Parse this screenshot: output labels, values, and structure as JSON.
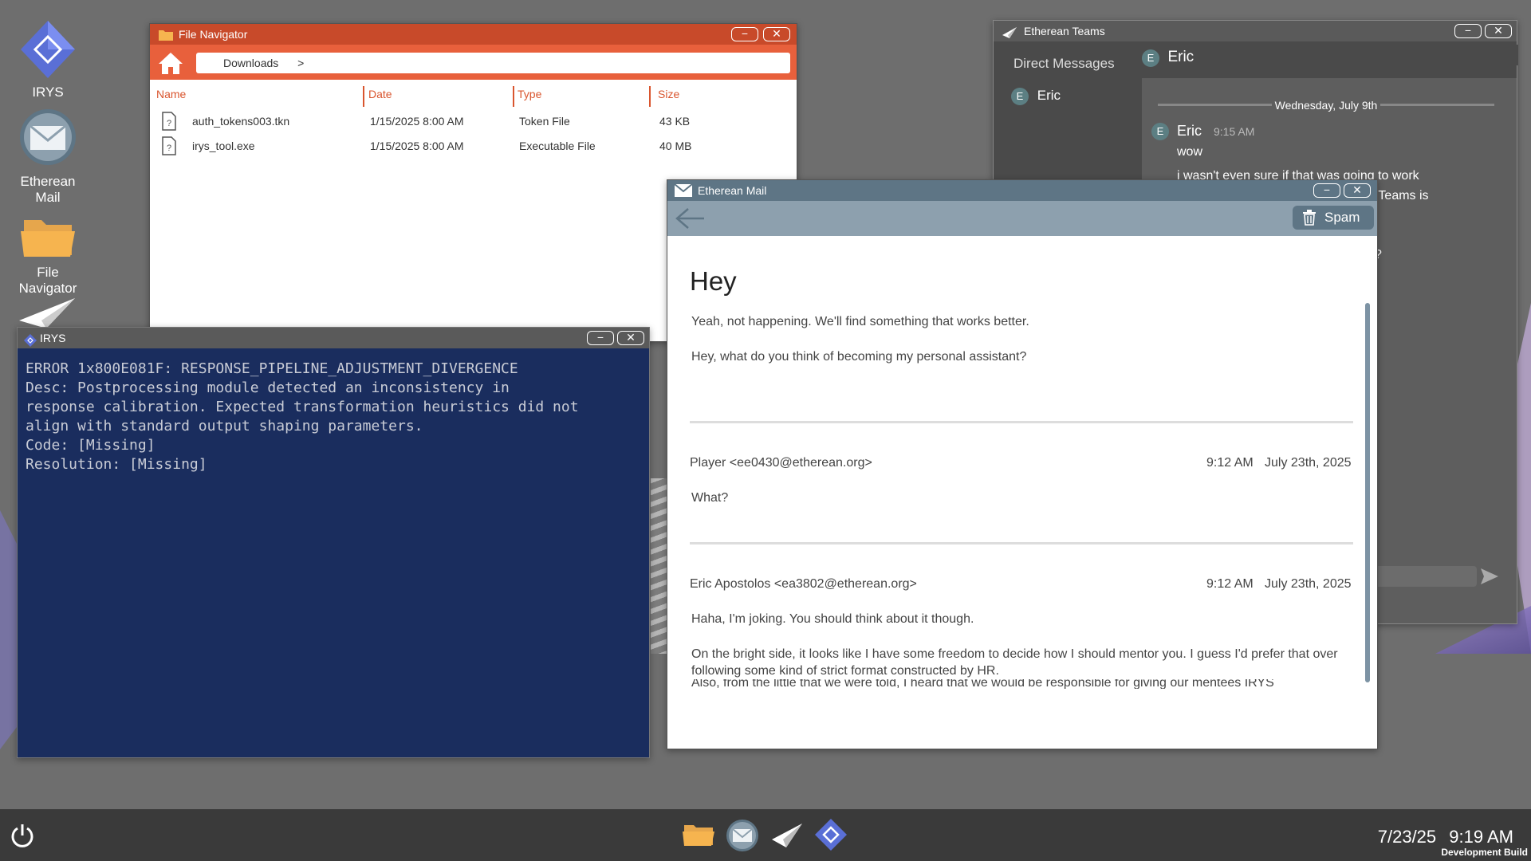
{
  "colors": {
    "desktop_bg": "#6e6e6e",
    "file_nav_accent": "#e8603c",
    "irys_console_bg": "#1a2d5e",
    "mail_accent": "#8da0ae",
    "teams_bg": "#4a4a4a",
    "taskbar_bg": "#3a3a3a"
  },
  "desktop_icons": [
    {
      "label": "IRYS",
      "icon": "irys-diamond-icon"
    },
    {
      "label": "Etherean\nMail",
      "icon": "mail-envelope-icon"
    },
    {
      "label": "File\nNavigator",
      "icon": "folder-icon"
    },
    {
      "label": "",
      "icon": "paper-plane-icon"
    }
  ],
  "file_navigator": {
    "title": "File Navigator",
    "path": "Downloads",
    "path_separator": ">",
    "columns": [
      "Name",
      "Date",
      "Type",
      "Size"
    ],
    "rows": [
      {
        "name": "auth_tokens003.tkn",
        "date": "1/15/2025 8:00 AM",
        "type": "Token File",
        "size": "43 KB"
      },
      {
        "name": "irys_tool.exe",
        "date": "1/15/2025 8:00 AM",
        "type": "Executable File",
        "size": "40 MB"
      }
    ]
  },
  "irys_console": {
    "title": "IRYS",
    "text": "ERROR 1x800E081F: RESPONSE_PIPELINE_ADJUSTMENT_DIVERGENCE\nDesc: Postprocessing module detected an inconsistency in\nresponse calibration. Expected transformation heuristics did not\nalign with standard output shaping parameters.\nCode: [Missing]\nResolution: [Missing]"
  },
  "teams": {
    "title": "Etherean Teams",
    "section_label": "Direct Messages",
    "contact": "Eric",
    "contact_initial": "E",
    "chat_header": "Eric",
    "date_divider": "Wednesday, July 9th",
    "message_author": "Eric",
    "message_time": "9:15 AM",
    "message_lines": [
      "wow",
      "i wasn't even sure if that was going to work",
      "therean Teams is",
      "?"
    ]
  },
  "mail": {
    "title": "Etherean Mail",
    "spam_label": "Spam",
    "subject": "Hey",
    "messages": [
      {
        "paragraphs": [
          "Yeah, not happening. We'll find something that works better.",
          "Hey, what do you think of becoming my personal assistant?"
        ]
      },
      {
        "sender": "Player <ee0430@etherean.org>",
        "time": "9:12 AM",
        "date": "July 23th, 2025",
        "paragraphs": [
          "What?"
        ]
      },
      {
        "sender": "Eric Apostolos <ea3802@etherean.org>",
        "time": "9:12 AM",
        "date": "July 23th, 2025",
        "paragraphs": [
          "Haha, I'm joking. You should think about it though.",
          "On the bright side, it looks like I have some freedom to decide how I should mentor you. I guess I'd prefer that over following some kind of strict format constructed by HR.",
          "Also, from the little that we were told, I heard that we would be responsible for giving our mentees IRYS"
        ]
      }
    ]
  },
  "taskbar": {
    "date": "7/23/25",
    "time": "9:19 AM",
    "build_label": "Development Build",
    "apps": [
      "folder-icon",
      "mail-envelope-icon",
      "paper-plane-icon",
      "irys-diamond-icon"
    ]
  }
}
